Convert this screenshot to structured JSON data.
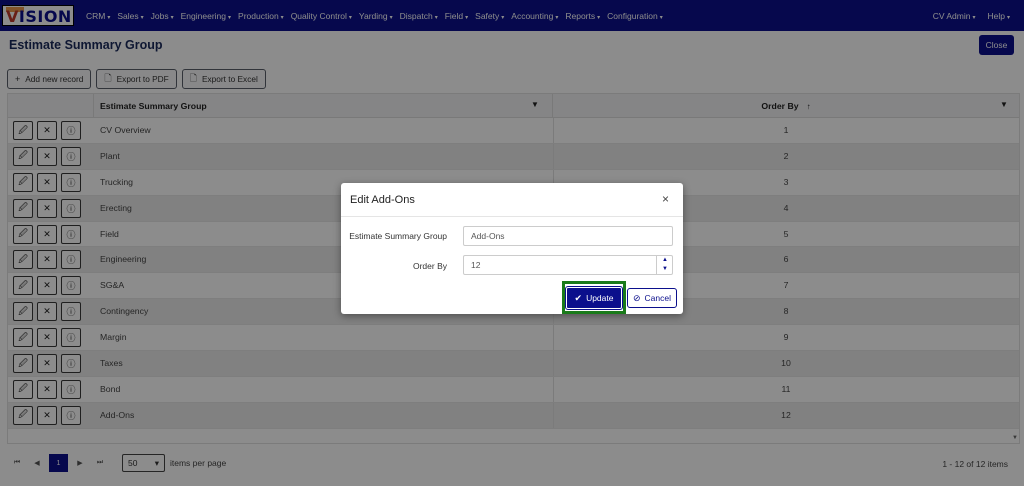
{
  "logo": {
    "first": "V",
    "rest": "ISION"
  },
  "nav": {
    "items": [
      "CRM",
      "Sales",
      "Jobs",
      "Engineering",
      "Production",
      "Quality Control",
      "Yarding",
      "Dispatch",
      "Field",
      "Safety",
      "Accounting",
      "Reports",
      "Configuration"
    ],
    "right": [
      "CV Admin",
      "Help"
    ],
    "caret": "▾"
  },
  "page": {
    "title": "Estimate Summary Group",
    "close_label": "Close"
  },
  "toolbar": {
    "add": "Add new record",
    "pdf": "Export to PDF",
    "excel": "Export to Excel"
  },
  "grid": {
    "col_name": "Estimate Summary Group",
    "col_order": "Order By",
    "sort_icon": "↑",
    "filter_icon": "▼",
    "action_icons": {
      "edit": "🖉",
      "delete": "✕",
      "info": "ⓘ"
    },
    "rows": [
      {
        "name": "CV Overview",
        "order": "1"
      },
      {
        "name": "Plant",
        "order": "2"
      },
      {
        "name": "Trucking",
        "order": "3"
      },
      {
        "name": "Erecting",
        "order": "4"
      },
      {
        "name": "Field",
        "order": "5"
      },
      {
        "name": "Engineering",
        "order": "6"
      },
      {
        "name": "SG&A",
        "order": "7"
      },
      {
        "name": "Contingency",
        "order": "8"
      },
      {
        "name": "Margin",
        "order": "9"
      },
      {
        "name": "Taxes",
        "order": "10"
      },
      {
        "name": "Bond",
        "order": "11"
      },
      {
        "name": "Add-Ons",
        "order": "12"
      }
    ]
  },
  "pager": {
    "first": "⏮",
    "prev": "◀",
    "current": "1",
    "next": "▶",
    "last": "⏭",
    "per_page": "50",
    "per_page_label": "items per page",
    "info": "1 - 12 of 12 items"
  },
  "modal": {
    "title": "Edit Add-Ons",
    "close": "×",
    "label_group": "Estimate Summary Group",
    "value_group": "Add-Ons",
    "label_order": "Order By",
    "value_order": "12",
    "update": "Update",
    "cancel": "Cancel"
  },
  "colors": {
    "primary": "#0b0f8c",
    "highlight": "#1a7a1a"
  }
}
